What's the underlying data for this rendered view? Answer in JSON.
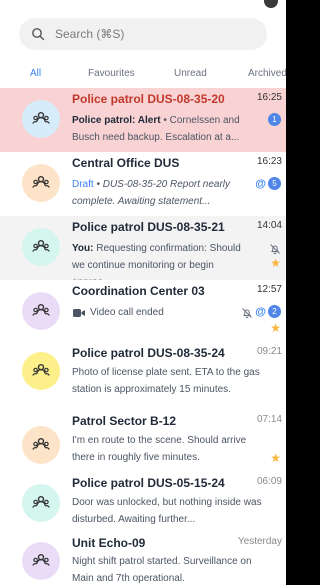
{
  "search": {
    "placeholder": "Search (⌘S)"
  },
  "tabs": [
    {
      "label": "All",
      "active": true
    },
    {
      "label": "Favourites",
      "active": false
    },
    {
      "label": "Unread",
      "active": false
    },
    {
      "label": "Archived",
      "active": false
    }
  ],
  "colors": {
    "accent": "#3b82f6",
    "alert_bg": "#f9d2d4",
    "alert_title": "#c0392b",
    "star": "#f6b73c"
  },
  "chats": [
    {
      "title": "Police patrol DUS-08-35-20",
      "time": "16:25",
      "prefix": "Police patrol: Alert",
      "preview": " • Cornelssen and Busch need backup. Escalation at a...",
      "badge": "1",
      "avatar_color": "#d7ecfb"
    },
    {
      "title": "Central Office DUS",
      "time": "16:23",
      "prefix": "Draft",
      "preview": " • DUS-08-35-20 Report nearly complete. Awaiting statement...",
      "badge": "5",
      "mention": "@",
      "avatar_color": "#fde3c7"
    },
    {
      "title": "Police patrol DUS-08-35-21",
      "time": "14:04",
      "prefix": "You:",
      "preview": " Requesting confirmation: Should we continue monitoring or begin approa...",
      "avatar_color": "#d5f5ef"
    },
    {
      "title": "Coordination Center 03",
      "time": "12:57",
      "preview": "Video call ended",
      "badge": "2",
      "mention": "@",
      "avatar_color": "#eadcf7"
    },
    {
      "title": "Police patrol DUS-08-35-24",
      "time": "09:21",
      "preview": "Photo of license plate sent. ETA to the gas station is approximately 15 minutes.",
      "avatar_color": "#fdf08a"
    },
    {
      "title": "Patrol Sector B-12",
      "time": "07:14",
      "preview": "I'm en route to the scene. Should arrive there in roughly five minutes.",
      "avatar_color": "#fde3c7"
    },
    {
      "title": "Police patrol DUS-05-15-24",
      "time": "06:09",
      "preview": "Door was unlocked, but nothing inside was disturbed. Awaiting further...",
      "avatar_color": "#d5f5ef"
    },
    {
      "title": "Unit Echo-09",
      "time": "Yesterday",
      "preview": "Night shift patrol started. Surveillance on Main and 7th operational.",
      "avatar_color": "#eadcf7"
    }
  ]
}
